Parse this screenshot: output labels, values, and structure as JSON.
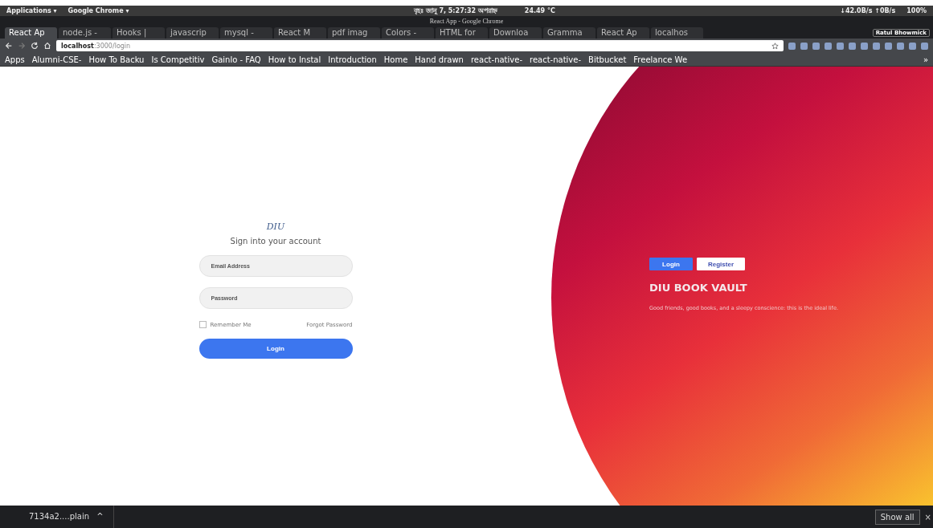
{
  "panel": {
    "menus": [
      "Applications ▾",
      "Google Chrome ▾"
    ],
    "clock": "বৃহঃ জানু 7, 5:27:32 অপরাহ্ন",
    "weather": "24.49 °C",
    "network": "↓42.0B/s ↑0B/s",
    "battery": "100%"
  },
  "window": {
    "title": "React App - Google Chrome",
    "profile": "Ratul Bhowmick"
  },
  "tabs": [
    {
      "label": "React Ap",
      "selected": true
    },
    {
      "label": "node.js -",
      "selected": false
    },
    {
      "label": "Hooks | ",
      "selected": false
    },
    {
      "label": "javascrip",
      "selected": false
    },
    {
      "label": "mysql - ",
      "selected": false
    },
    {
      "label": "React M",
      "selected": false
    },
    {
      "label": "pdf imag",
      "selected": false
    },
    {
      "label": "Colors - ",
      "selected": false
    },
    {
      "label": "HTML for",
      "selected": false
    },
    {
      "label": "Downloa",
      "selected": false
    },
    {
      "label": "Gramma",
      "selected": false
    },
    {
      "label": "React Ap",
      "selected": false
    },
    {
      "label": "localhos",
      "selected": false
    }
  ],
  "address_bar": {
    "host": "localhost",
    "path": ":3000/login"
  },
  "bookmarks": [
    "Apps",
    "Alumni-CSE-",
    "How To Backu",
    "Is Competitiv",
    "Gainlo - FAQ",
    "How to Instal",
    "Introduction",
    "Home",
    "Hand drawn",
    "react-native-",
    "react-native-",
    "Bitbucket",
    "Freelance We"
  ],
  "bookmarks_more": "»",
  "login_form": {
    "logo": "DIU",
    "heading": "Sign into your account",
    "email": {
      "placeholder": "Email Address"
    },
    "password": {
      "placeholder": "Password"
    },
    "remember_me": {
      "label": "Remember Me",
      "checked": false
    },
    "forgot_link": "Forgot Password",
    "submit": "Login"
  },
  "hero": {
    "toggle": [
      {
        "label": "Login",
        "selected": true
      },
      {
        "label": "Register",
        "selected": false
      }
    ],
    "title": "DIU BOOK VAULT",
    "quote": "Good friends, good books, and a sleepy conscience: this is the ideal life."
  },
  "download_bar": {
    "file": "7134a2....plain",
    "caret": "^",
    "show_all": "Show all",
    "close": "×"
  }
}
